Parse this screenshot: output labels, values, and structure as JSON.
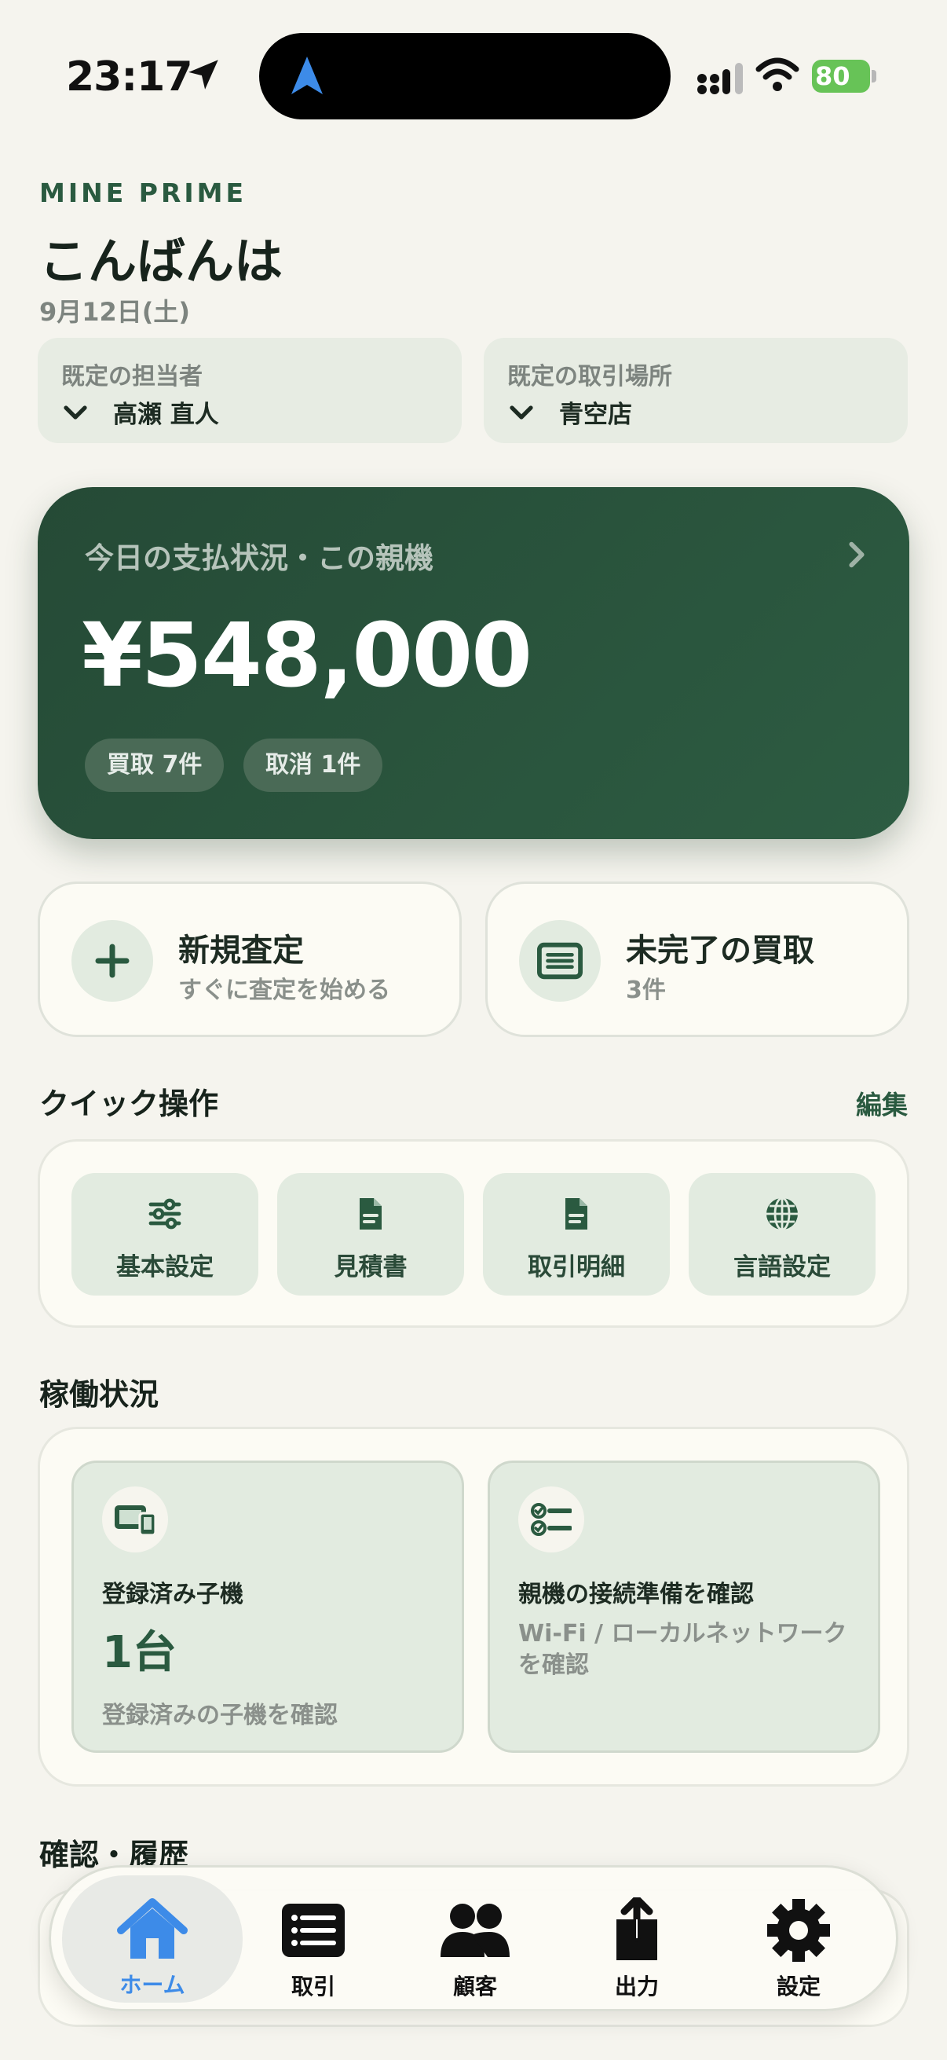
{
  "status_bar": {
    "time": "23:17",
    "battery": "80"
  },
  "brand": "MINE PRIME",
  "greeting": "こんばんは",
  "date": "9月12日(土)",
  "selectors": [
    {
      "label": "既定の担当者",
      "value": "高瀬 直人"
    },
    {
      "label": "既定の取引場所",
      "value": "青空店"
    }
  ],
  "hero": {
    "title": "今日の支払状況・この親機",
    "amount": "¥548,000",
    "pills": [
      "買取 7件",
      "取消 1件"
    ]
  },
  "actions": [
    {
      "title": "新規査定",
      "subtitle": "すぐに査定を始める",
      "icon": "plus-icon"
    },
    {
      "title": "未完了の買取",
      "subtitle": "3件",
      "icon": "list-icon"
    }
  ],
  "quick": {
    "title": "クイック操作",
    "edit": "編集",
    "items": [
      {
        "label": "基本設定",
        "icon": "sliders-icon"
      },
      {
        "label": "見積書",
        "icon": "document-icon"
      },
      {
        "label": "取引明細",
        "icon": "document-icon"
      },
      {
        "label": "言語設定",
        "icon": "globe-icon"
      }
    ]
  },
  "operation": {
    "title": "稼働状況",
    "cards": [
      {
        "label": "登録済み子機",
        "value": "1台",
        "desc": "登録済みの子機を確認",
        "icon": "devices-icon"
      },
      {
        "label": "親機の接続準備を確認",
        "desc": "Wi-Fi / ローカルネットワークを確認",
        "icon": "checklist-icon"
      }
    ]
  },
  "history": {
    "title": "確認・履歴"
  },
  "tabs": [
    {
      "label": "ホーム",
      "icon": "house-icon",
      "active": true
    },
    {
      "label": "取引",
      "icon": "list-icon"
    },
    {
      "label": "顧客",
      "icon": "people-icon"
    },
    {
      "label": "出力",
      "icon": "share-icon"
    },
    {
      "label": "設定",
      "icon": "gear-icon"
    }
  ],
  "colors": {
    "accent": "#2a5a40",
    "hero": "#254a36",
    "tab_active": "#3d8be8",
    "background": "#f5f4ee"
  }
}
